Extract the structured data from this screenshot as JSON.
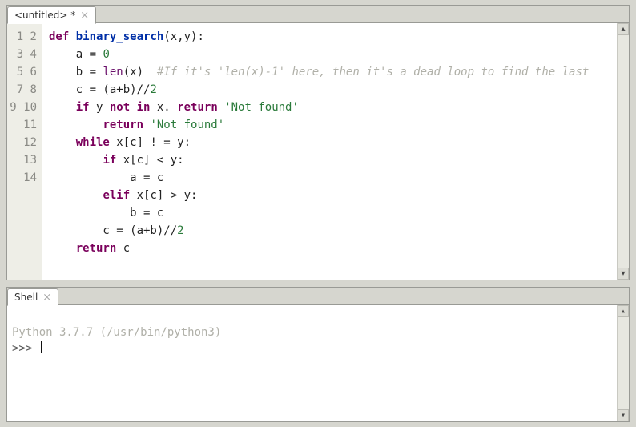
{
  "editor": {
    "tab_title": "<untitled> *",
    "line_count": 14,
    "code_lines": [
      {
        "type": "def",
        "name": "binary_search",
        "params": "(x,y)"
      },
      {
        "type": "assign",
        "indent": 1,
        "lhs": "a",
        "eq": "=",
        "rhs_num": "0"
      },
      {
        "type": "lenline",
        "indent": 1,
        "lhs": "b",
        "eq": "=",
        "fn": "len",
        "arg": "(x)",
        "comment": "#If it's 'len(x)-1' here, then it's a dead loop to find the last"
      },
      {
        "type": "expr",
        "indent": 1,
        "text_pre": "c = (a+b)//",
        "num": "2"
      },
      {
        "type": "ifret",
        "indent": 1,
        "kw1": "if",
        "mid": " y ",
        "kw2": "not in",
        "post": " x. ",
        "kw3": "return",
        "str": "'Not found'"
      },
      {
        "type": "ret",
        "indent": 2,
        "kw": "return",
        "str": "'Not found'"
      },
      {
        "type": "while",
        "indent": 1,
        "kw": "while",
        "body": " x[c] ! = y:"
      },
      {
        "type": "if",
        "indent": 2,
        "kw": "if",
        "body": " x[c] < y:"
      },
      {
        "type": "plain",
        "indent": 3,
        "text": "a = c"
      },
      {
        "type": "elif",
        "indent": 2,
        "kw": "elif",
        "body": " x[c] > y:"
      },
      {
        "type": "plain",
        "indent": 3,
        "text": "b = c"
      },
      {
        "type": "expr",
        "indent": 2,
        "text_pre": "c = (a+b)//",
        "num": "2"
      },
      {
        "type": "retc",
        "indent": 1,
        "kw": "return",
        "post": " c"
      },
      {
        "type": "blank"
      }
    ]
  },
  "shell": {
    "tab_title": "Shell",
    "banner": "Python 3.7.7 (/usr/bin/python3)",
    "prompt": ">>>"
  }
}
